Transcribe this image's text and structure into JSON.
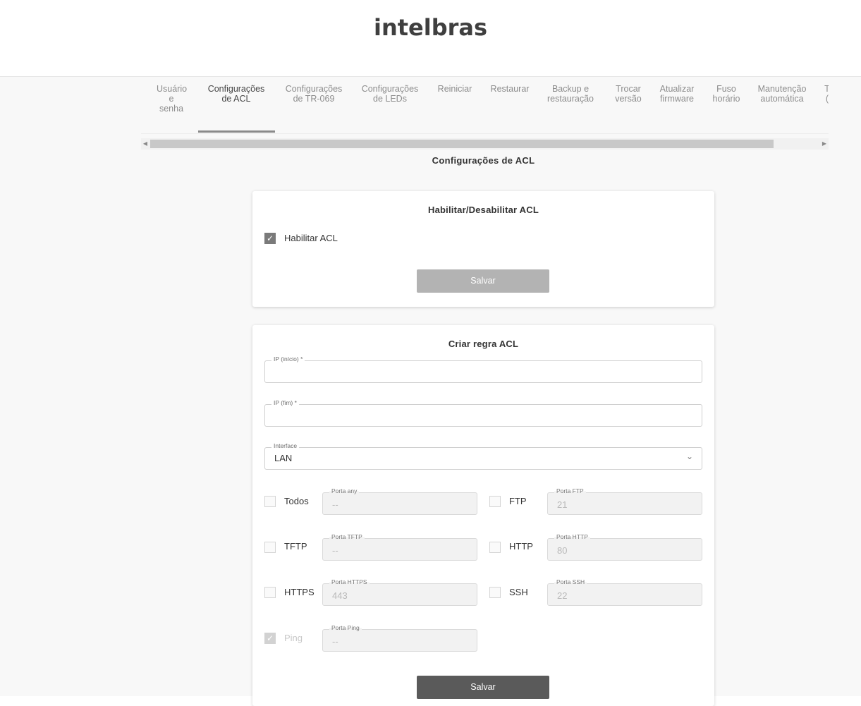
{
  "brand": {
    "logo_text": "intelbras"
  },
  "tabs": [
    {
      "label": "Usuário\ne\nsenha"
    },
    {
      "label": "Configurações\nde ACL"
    },
    {
      "label": "Configurações\nde TR-069"
    },
    {
      "label": "Configurações\nde LEDs"
    },
    {
      "label": "Reiniciar"
    },
    {
      "label": "Restaurar"
    },
    {
      "label": "Backup e\nrestauração"
    },
    {
      "label": "Trocar\nversão"
    },
    {
      "label": "Atualizar\nfirmware"
    },
    {
      "label": "Fuso\nhorário"
    },
    {
      "label": "Manutenção\nautomática"
    },
    {
      "label": "T\n("
    }
  ],
  "page": {
    "title": "Configurações de ACL"
  },
  "enable_card": {
    "title": "Habilitar/Desabilitar ACL",
    "checkbox_label": "Habilitar ACL",
    "checkbox_checked": true,
    "save_label": "Salvar"
  },
  "rule_card": {
    "title": "Criar regra ACL",
    "ip_start": {
      "label": "IP (início) *",
      "value": ""
    },
    "ip_end": {
      "label": "IP (fim) *",
      "value": ""
    },
    "interface": {
      "label": "Interface",
      "value": "LAN"
    },
    "protocols": {
      "todos": {
        "label": "Todos",
        "port_label": "Porta any",
        "port_value": "--"
      },
      "ftp": {
        "label": "FTP",
        "port_label": "Porta FTP",
        "port_value": "21"
      },
      "tftp": {
        "label": "TFTP",
        "port_label": "Porta TFTP",
        "port_value": "--"
      },
      "http": {
        "label": "HTTP",
        "port_label": "Porta HTTP",
        "port_value": "80"
      },
      "https": {
        "label": "HTTPS",
        "port_label": "Porta HTTPS",
        "port_value": "443"
      },
      "ssh": {
        "label": "SSH",
        "port_label": "Porta SSH",
        "port_value": "22"
      },
      "ping": {
        "label": "Ping",
        "port_label": "Porta Ping",
        "port_value": "--"
      }
    },
    "save_label": "Salvar"
  },
  "icons": {
    "check": "check-icon",
    "chevron": "chevron-down-icon",
    "scroll_left": "scroll-left-icon",
    "scroll_right": "scroll-right-icon"
  }
}
